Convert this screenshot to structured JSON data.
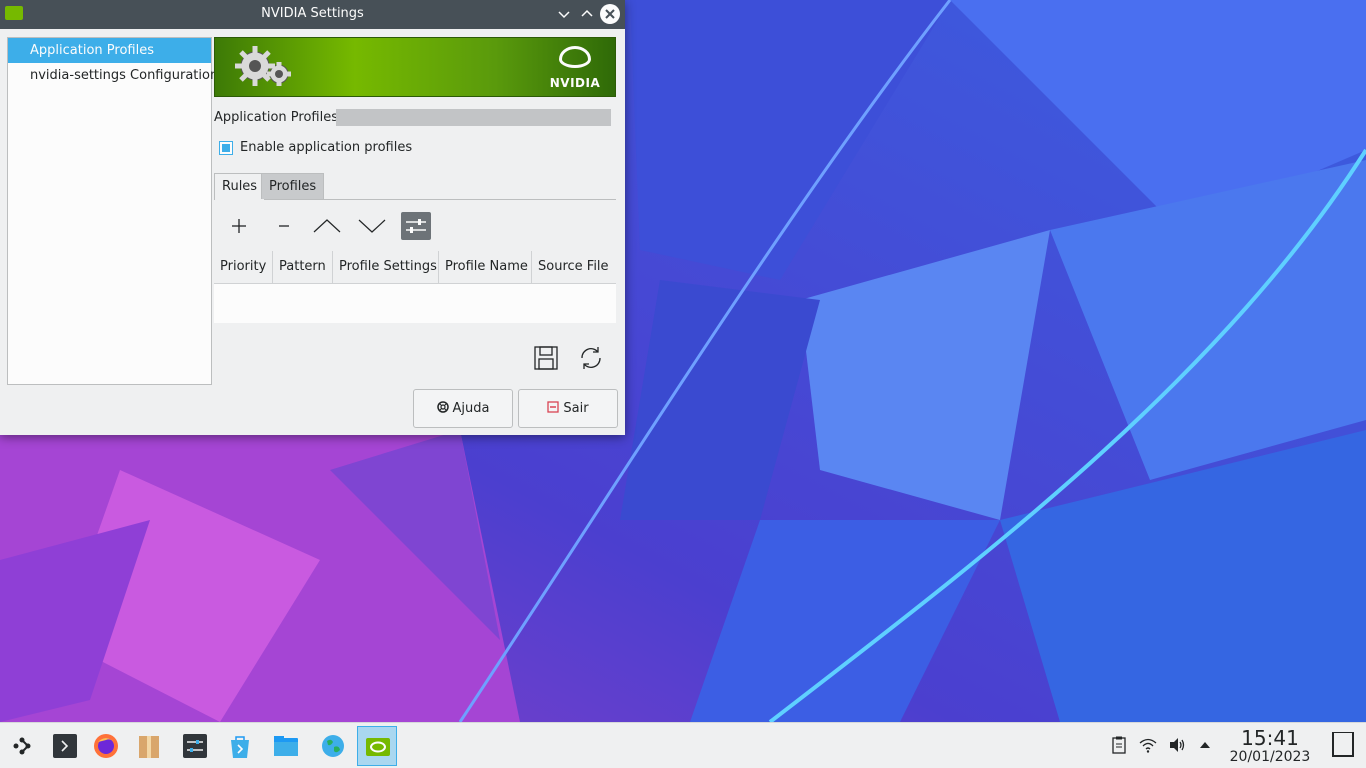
{
  "window": {
    "title": "NVIDIA Settings"
  },
  "sidebar": {
    "items": [
      {
        "label": "Application Profiles"
      },
      {
        "label": "nvidia-settings Configuration"
      }
    ]
  },
  "banner": {
    "brand": "NVIDIA"
  },
  "main": {
    "section_label": "Application Profiles",
    "enable_checkbox": {
      "label": "Enable application profiles",
      "checked": true
    },
    "tabs": [
      {
        "label": "Rules"
      },
      {
        "label": "Profiles"
      }
    ],
    "table": {
      "columns": [
        "Priority",
        "Pattern",
        "Profile Settings",
        "Profile Name",
        "Source File"
      ]
    },
    "help_button": "Ajuda",
    "quit_button": "Sair"
  },
  "taskbar": {
    "apps": [
      "application-launcher-icon",
      "konsole-icon",
      "firefox-icon",
      "ark-icon",
      "system-settings-icon",
      "discover-icon",
      "dolphin-icon",
      "globe-icon",
      "nvidia-settings-icon"
    ],
    "clock": {
      "time": "15:41",
      "date": "20/01/2023"
    }
  },
  "colors": {
    "accent": "#3daee9",
    "nvidia_green": "#76b900",
    "titlebar": "#475057"
  }
}
